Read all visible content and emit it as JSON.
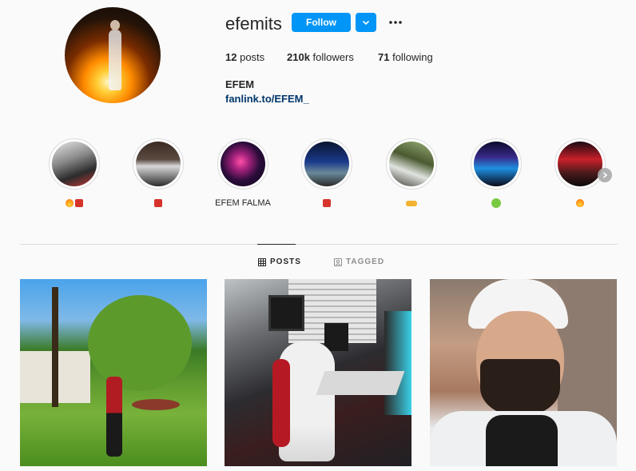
{
  "profile": {
    "username": "efemits",
    "follow_label": "Follow",
    "stats": {
      "posts": "12",
      "posts_label": "posts",
      "followers": "210k",
      "followers_label": "followers",
      "following": "71",
      "following_label": "following"
    },
    "full_name": "EFEM",
    "link": "fanlink.to/EFEM_"
  },
  "highlights": [
    {
      "label": "",
      "emojis": [
        "fire",
        "hundred"
      ],
      "colors": [
        "#d9d9d9",
        "#3a3a3a"
      ]
    },
    {
      "label": "",
      "emojis": [
        "hundred"
      ],
      "colors": [
        "#3a2a22",
        "#c8c8c8"
      ]
    },
    {
      "label": "EFEM FALMA",
      "emojis": [],
      "colors": [
        "#1a0b2a",
        "#e6409a"
      ]
    },
    {
      "label": "",
      "emojis": [
        "hundred"
      ],
      "colors": [
        "#0b1a3a",
        "#2a5bd4"
      ]
    },
    {
      "label": "",
      "emojis": [
        "handshake"
      ],
      "colors": [
        "#3c4a28",
        "#cfd8c8"
      ]
    },
    {
      "label": "",
      "emojis": [
        "money-face"
      ],
      "colors": [
        "#0c0c2a",
        "#1e8fe0"
      ]
    },
    {
      "label": "",
      "emojis": [
        "fire"
      ],
      "colors": [
        "#2a0c10",
        "#c8202a"
      ]
    }
  ],
  "tabs": {
    "posts": "POSTS",
    "tagged": "TAGGED"
  },
  "colors": {
    "accent": "#0095f6",
    "link": "#00376b"
  }
}
